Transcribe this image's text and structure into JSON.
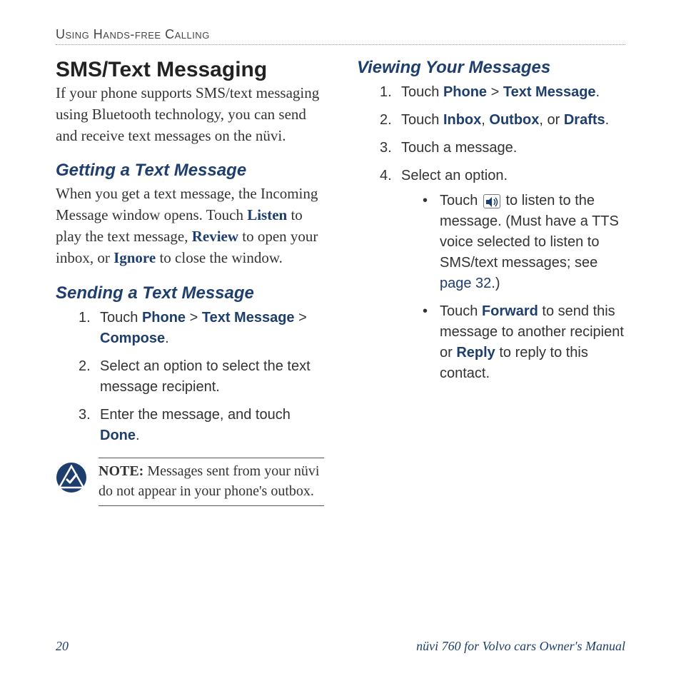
{
  "header": "Using Hands-free Calling",
  "left": {
    "title": "SMS/Text Messaging",
    "intro": "If your phone supports SMS/text messaging using Bluetooth technology, you can send and receive text messages on the nüvi.",
    "section1": {
      "heading": "Getting a Text Message",
      "p1_a": "When you get a text message, the Incoming Message window opens. Touch ",
      "listen": "Listen",
      "p1_b": " to play the text message, ",
      "review": "Review",
      "p1_c": " to open your inbox, or ",
      "ignore": "Ignore",
      "p1_d": " to close the window."
    },
    "section2": {
      "heading": "Sending a Text Message",
      "step1_a": "Touch ",
      "step1_phone": "Phone",
      "step1_gt1": " > ",
      "step1_text": "Text Message",
      "step1_gt2": " > ",
      "step1_compose": "Compose",
      "step1_end": ".",
      "step2": "Select an option to select the text message recipient.",
      "step3_a": "Enter the message, and touch ",
      "step3_done": "Done",
      "step3_end": "."
    },
    "note": {
      "label": "NOTE:",
      "text": " Messages sent from your nüvi do not appear in your phone's outbox."
    }
  },
  "right": {
    "heading": "Viewing Your Messages",
    "step1_a": "Touch ",
    "step1_phone": "Phone",
    "step1_gt": " > ",
    "step1_text": "Text Message",
    "step1_end": ".",
    "step2_a": "Touch ",
    "step2_inbox": "Inbox",
    "step2_c1": ", ",
    "step2_outbox": "Outbox",
    "step2_c2": ", or ",
    "step2_drafts": "Drafts",
    "step2_end": ".",
    "step3": "Touch a message.",
    "step4": "Select an option.",
    "bullet1_a": "Touch ",
    "bullet1_b": " to listen to the message. (Must have a TTS voice selected to listen to SMS/text messages; see ",
    "bullet1_page": "page 32",
    "bullet1_end": ".)",
    "bullet2_a": "Touch ",
    "bullet2_forward": "Forward",
    "bullet2_b": " to send this message to another recipient or ",
    "bullet2_reply": "Reply",
    "bullet2_c": " to reply to this contact."
  },
  "footer": {
    "page": "20",
    "title": "nüvi 760 for Volvo cars Owner's Manual"
  }
}
